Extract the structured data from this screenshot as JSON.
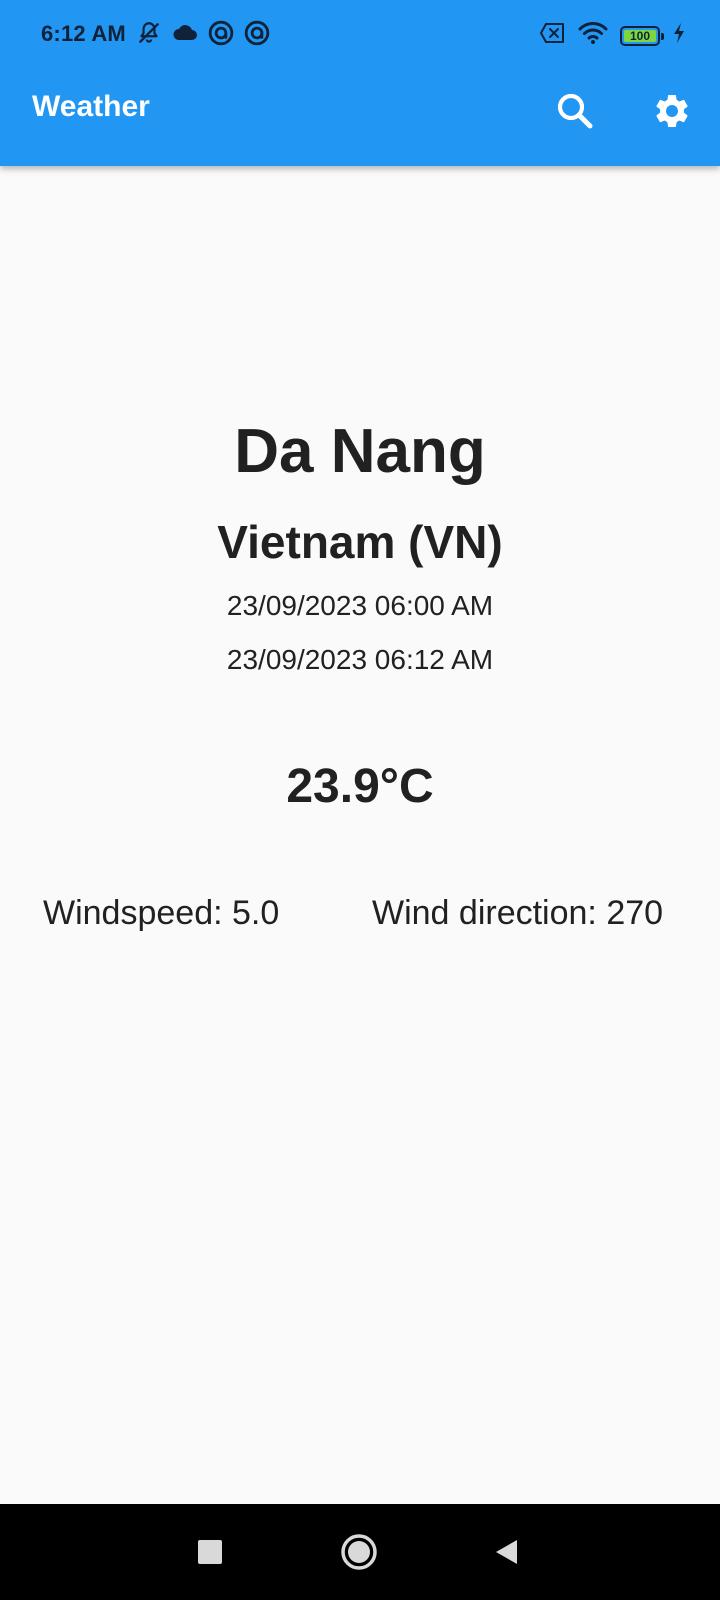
{
  "status_bar": {
    "time": "6:12 AM",
    "battery_level": "100",
    "icons": [
      "bell-off-icon",
      "cloud-icon",
      "notification-ring-icon",
      "notification-ring-icon",
      "no-sim-icon",
      "wifi-icon",
      "battery-icon",
      "charging-bolt-icon"
    ]
  },
  "app_bar": {
    "title": "Weather",
    "actions": [
      "search-icon",
      "gear-icon"
    ]
  },
  "weather": {
    "city": "Da Nang",
    "country": "Vietnam (VN)",
    "date_primary": "23/09/2023 06:00 AM",
    "date_secondary": "23/09/2023 06:12 AM",
    "temperature": "23.9°C",
    "windspeed": "Windspeed: 5.0",
    "wind_direction": "Wind direction: 270"
  },
  "navigation_bar": {
    "buttons": [
      "recents-square-icon",
      "home-circle-icon",
      "back-triangle-icon"
    ]
  },
  "colors": {
    "primary": "#2196f3",
    "background": "#fafafa",
    "text": "#212121",
    "status_text": "#10223a",
    "battery_fill": "#7cd640",
    "nav_bar": "#000000"
  }
}
